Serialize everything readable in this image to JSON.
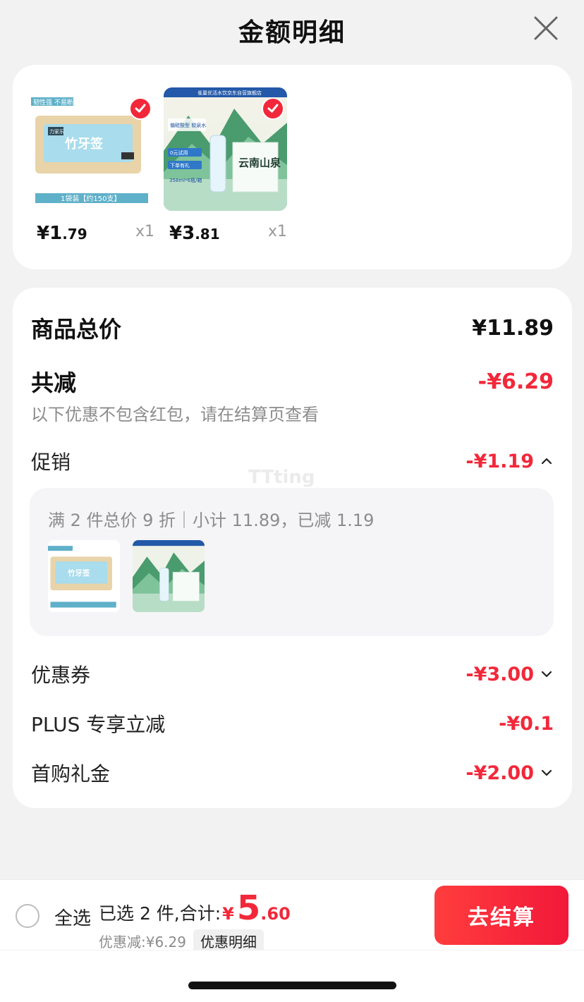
{
  "header": {
    "title": "金额明细",
    "close_icon": "close-icon"
  },
  "products": [
    {
      "price_int": "¥1",
      "price_dec": ".79",
      "qty": "x1",
      "selected": true,
      "thumb": {
        "tag": "韧性强 不易断",
        "name": "竹牙签",
        "pack": "1袋装【约150支】",
        "brand": "力家乐"
      }
    },
    {
      "price_int": "¥3",
      "price_dec": ".81",
      "qty": "x1",
      "selected": true,
      "thumb": {
        "banner": "雀巢优活水饮京东自营旗舰店",
        "tag": "偏硅酸型 软泉水",
        "line1": "0元试用",
        "line2": "下单有礼",
        "spec": "358ml*6瓶/箱",
        "box_brand": "云南山泉"
      }
    }
  ],
  "summary": {
    "goods_total_label": "商品总价",
    "goods_total_value": "¥11.89",
    "total_reduce_label": "共减",
    "total_reduce_value": "-¥6.29",
    "note": "以下优惠不包含红包，请在结算页查看",
    "promotion": {
      "label": "促销",
      "value": "-¥1.19",
      "detail": "满 2 件总价 9 折｜小计 11.89，已减 1.19"
    },
    "coupon": {
      "label": "优惠券",
      "value": "-¥3.00"
    },
    "plus": {
      "label": "PLUS 专享立减",
      "value": "-¥0.1"
    },
    "first_gift": {
      "label": "首购礼金",
      "value": "-¥2.00"
    }
  },
  "watermark": "TTting",
  "bottom_bar": {
    "select_all": "全选",
    "selected_label": "已选 2 件,合计:",
    "currency": "¥",
    "total_int": "5",
    "total_dec": ".60",
    "discount_text": "优惠减:¥6.29",
    "detail_chip": "优惠明细",
    "checkout": "去结算"
  },
  "colors": {
    "accent": "#f2283a",
    "muted": "#8c8c8c",
    "background": "#f2f2f2"
  }
}
